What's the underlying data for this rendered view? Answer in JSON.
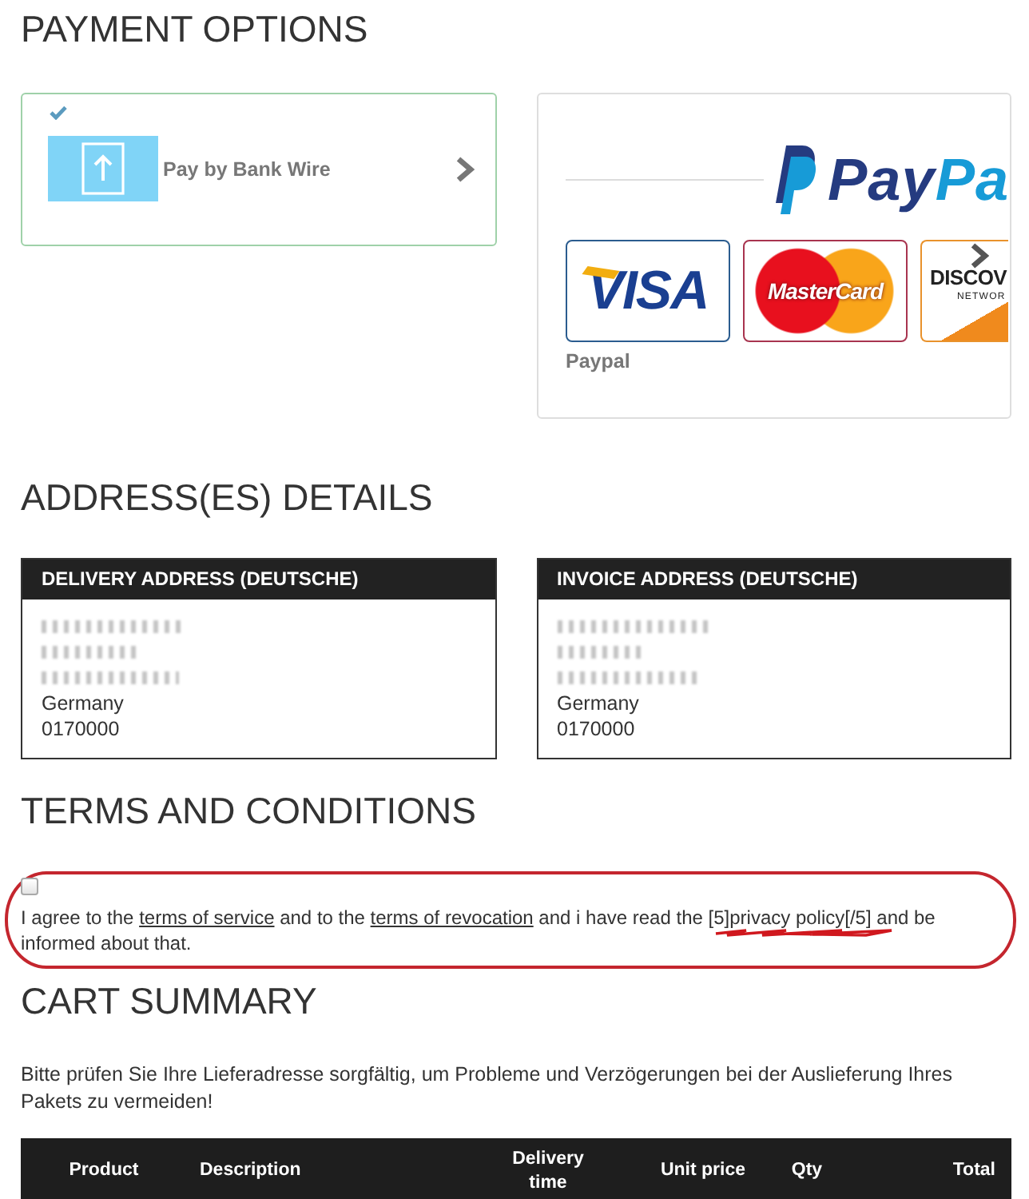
{
  "payment": {
    "title": "PAYMENT OPTIONS",
    "options": [
      {
        "kind": "bank_wire",
        "label": "Pay by Bank Wire",
        "selected": true
      },
      {
        "kind": "paypal",
        "label": "Paypal",
        "selected": false,
        "wordmark": [
          "Pay",
          "Pa"
        ],
        "cards": [
          {
            "kind": "visa",
            "text": "VISA"
          },
          {
            "kind": "mastercard",
            "text": "MasterCard"
          },
          {
            "kind": "discover",
            "text": "DISCOV",
            "subtext": "NETWOR"
          }
        ]
      }
    ]
  },
  "addresses": {
    "title": "ADDRESS(ES) DETAILS",
    "boxes": [
      {
        "title": "DELIVERY ADDRESS (DEUTSCHE)",
        "lines": [
          {
            "kind": "redacted"
          },
          {
            "kind": "redacted"
          },
          {
            "kind": "redacted"
          },
          {
            "kind": "text",
            "text": "Germany"
          },
          {
            "kind": "text",
            "text": "0170000"
          }
        ]
      },
      {
        "title": "INVOICE ADDRESS (DEUTSCHE)",
        "lines": [
          {
            "kind": "redacted"
          },
          {
            "kind": "redacted"
          },
          {
            "kind": "redacted"
          },
          {
            "kind": "text",
            "text": "Germany"
          },
          {
            "kind": "text",
            "text": "0170000"
          }
        ]
      }
    ]
  },
  "terms": {
    "title": "TERMS AND CONDITIONS",
    "checked": false,
    "circled": true,
    "segments": [
      {
        "kind": "text",
        "text": "I agree to the ",
        "scribbled": false
      },
      {
        "kind": "link",
        "text": "terms of service",
        "scribbled": false
      },
      {
        "kind": "text",
        "text": " and to the ",
        "scribbled": false
      },
      {
        "kind": "link",
        "text": "terms of revocation",
        "scribbled": false
      },
      {
        "kind": "text",
        "text": " and i have read the ",
        "scribbled": false
      },
      {
        "kind": "text",
        "text": "[5]privacy policy[/5]",
        "scribbled": true
      },
      {
        "kind": "text",
        "text": " and be informed about that.",
        "scribbled": false
      }
    ]
  },
  "cart": {
    "title": "CART SUMMARY",
    "notice": "Bitte prüfen Sie Ihre Lieferadresse sorgfältig, um Probleme und Verzögerungen bei der Auslieferung Ihres Pakets zu vermeiden!",
    "columns": [
      "Product",
      "Description",
      "Delivery time",
      "Unit price",
      "Qty",
      "Total"
    ]
  }
}
